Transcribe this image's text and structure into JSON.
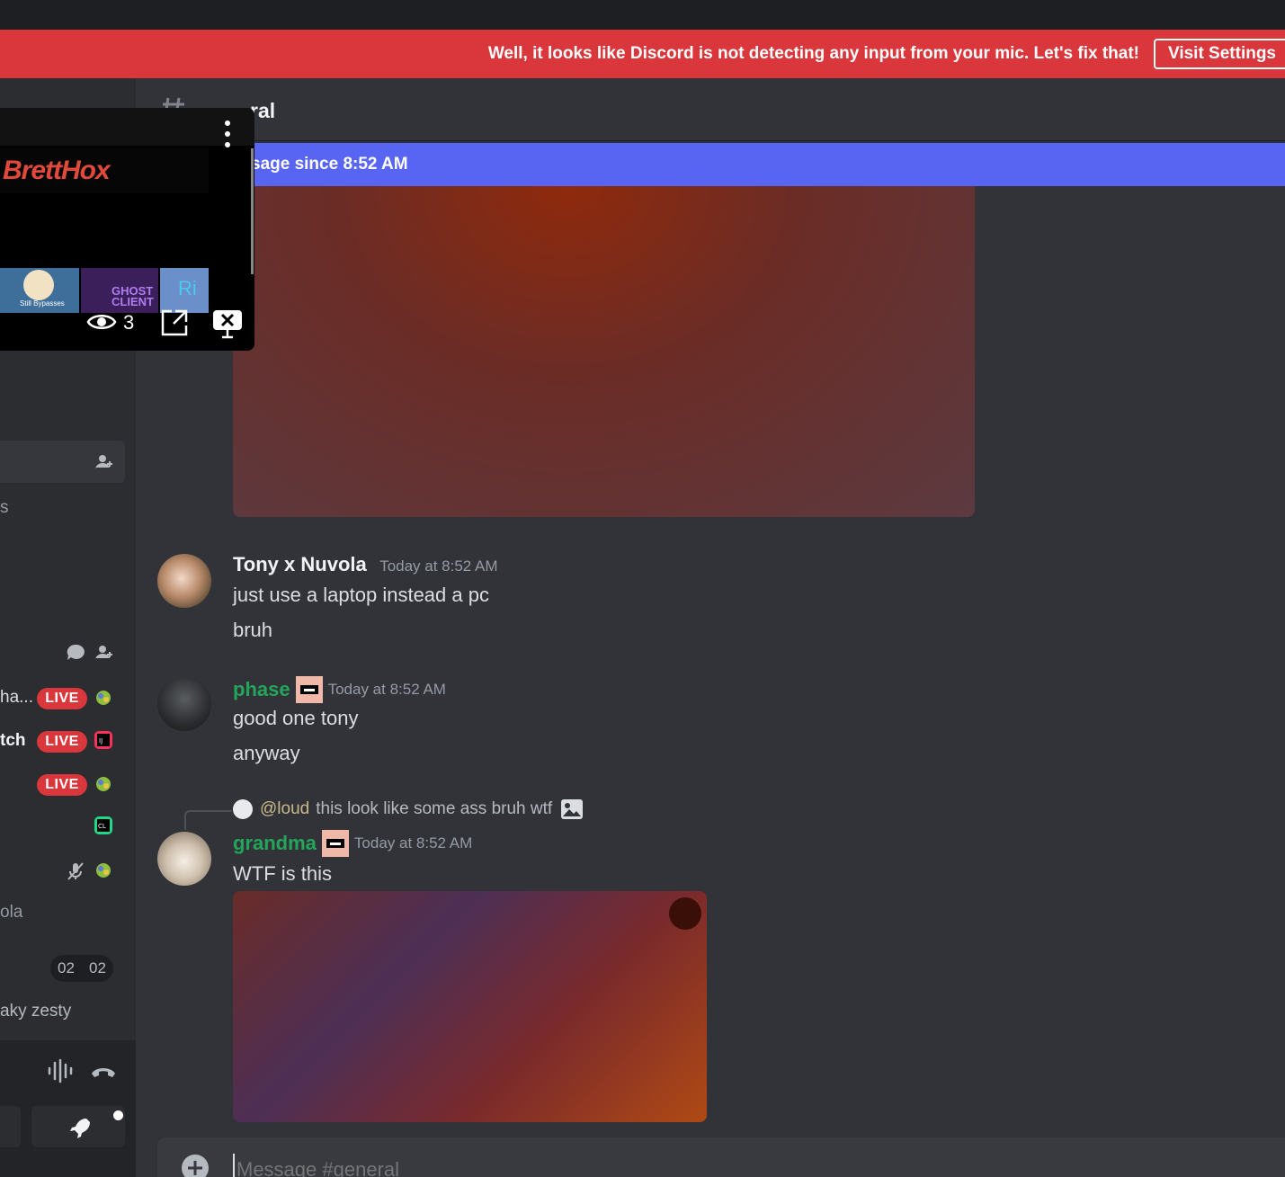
{
  "notice": {
    "message": "Well, it looks like Discord is not detecting any input from your mic. Let's fix that!",
    "button_label": "Visit Settings"
  },
  "channel": {
    "name_fragment": "ral"
  },
  "new_messages_bar": {
    "text": "sage since 8:52 AM"
  },
  "stream_popout": {
    "logo_text": "BrettHox",
    "viewer_count": "3",
    "thumb_captions": [
      "Still Bypasses",
      "GHOST CLIENT",
      "Ri"
    ]
  },
  "sidebar": {
    "partial_label_1": "s",
    "voice_members": [
      {
        "name": "ha...",
        "live": "LIVE",
        "app_icon": "controller-icon"
      },
      {
        "name": "tch",
        "live": "LIVE",
        "app_icon": "intellij-icon"
      },
      {
        "name": "",
        "live": "LIVE",
        "app_icon": "controller-icon"
      },
      {
        "name": "",
        "live": "",
        "app_icon": "clion-icon"
      },
      {
        "name": "",
        "live": "",
        "app_icon": "controller-icon"
      }
    ],
    "member_nuvola": "ola",
    "time_left": "02",
    "time_right": "02",
    "activity_text": "aky zesty"
  },
  "messages": [
    {
      "user": "Tony x Nuvola",
      "timestamp": "Today at 8:52 AM",
      "lines": [
        "just use a laptop instead a pc",
        "bruh"
      ],
      "color": "#f2f3f5"
    },
    {
      "user": "phase",
      "timestamp": "Today at 8:52 AM",
      "lines": [
        "good one tony",
        "anyway"
      ],
      "color": "#23a55a"
    },
    {
      "user": "grandma",
      "timestamp": "Today at 8:52 AM",
      "lines": [
        "WTF is this"
      ],
      "color": "#23a55a",
      "reply": {
        "mention": "@loud",
        "text": "this look like some ass bruh wtf"
      }
    }
  ],
  "composer": {
    "placeholder": "Message #general"
  },
  "colors": {
    "accent": "#5865f2",
    "danger": "#da373c",
    "online_green": "#23a55a"
  }
}
